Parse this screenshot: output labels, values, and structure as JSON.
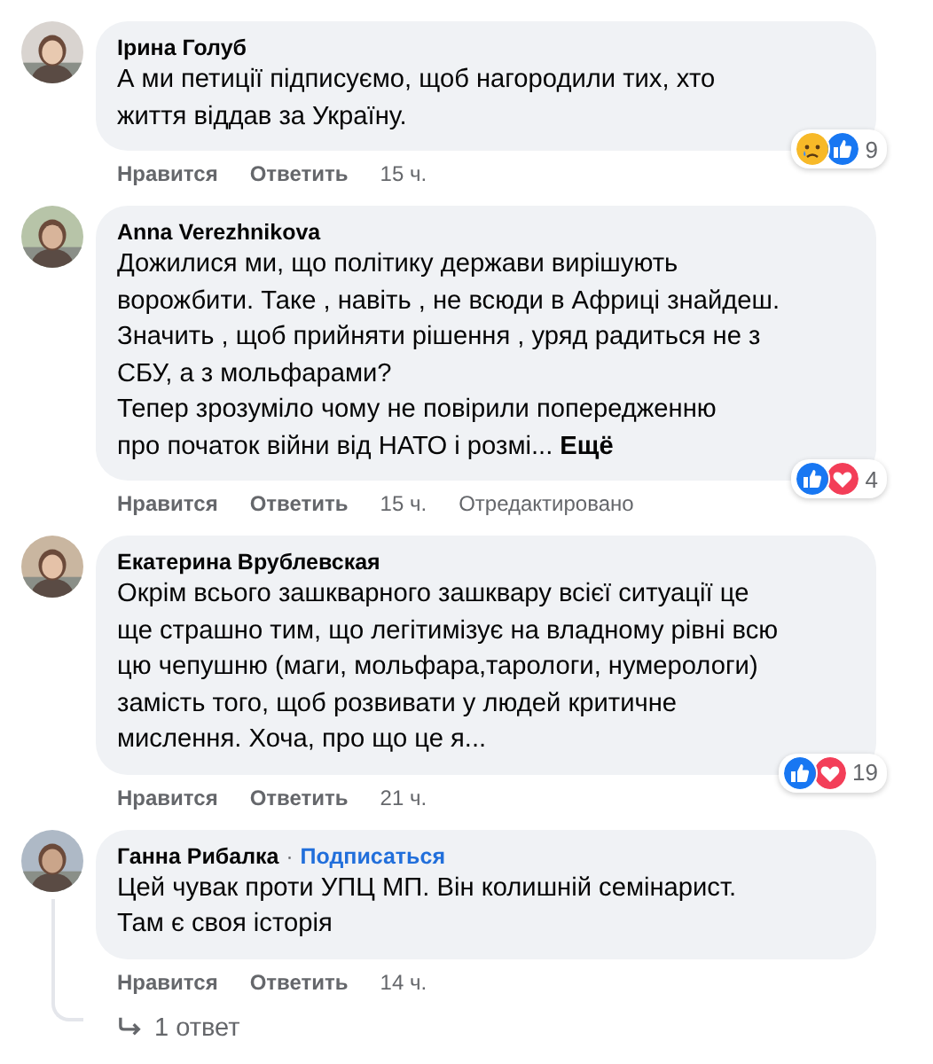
{
  "comments": [
    {
      "author": "Ірина Голуб",
      "body": "А ми петиції підписуємо, щоб нагородили тих, хто\nжиття віддав за Україну.",
      "reactions": [
        {
          "kind": "sad"
        },
        {
          "kind": "like"
        }
      ],
      "reaction_count": "9",
      "actions": [
        "Нравится",
        "Ответить"
      ],
      "time": "15 ч."
    },
    {
      "author": "Anna Verezhnikova",
      "body": "Дожилися ми, що політику держави вирішують\nворожбити. Таке , навіть , не всюди в Африці знайдеш.\nЗначить , щоб прийняти рішення , уряд радиться не з\nСБУ, а з мольфарами?\nТепер зрозуміло чому не повірили попередженню\nпро початок війни від НАТО і розмі...",
      "more_link": "Ещё",
      "reactions": [
        {
          "kind": "like"
        },
        {
          "kind": "love"
        }
      ],
      "reaction_count": "4",
      "actions": [
        "Нравится",
        "Ответить"
      ],
      "time": "15 ч.",
      "edited": "Отредактировано"
    },
    {
      "author": "Екатерина Врублевская",
      "body": "Окрім всього зашкварного зашквару всієї ситуації це\nще страшно тим, що легітимізує на владному рівні всю\nцю чепушню (маги, мольфара,тарологи, нумерологи)\nзамість того, щоб розвивати у людей критичне\nмислення. Хоча, про що це я...",
      "reactions": [
        {
          "kind": "like"
        },
        {
          "kind": "love"
        }
      ],
      "reaction_count": "19",
      "actions": [
        "Нравится",
        "Ответить"
      ],
      "time": "21 ч."
    },
    {
      "author": "Ганна Рибалка",
      "separator": "·",
      "follow": "Подписаться",
      "body": "Цей чувак проти УПЦ МП. Він колишній семінарист.\nТам є своя історія",
      "actions": [
        "Нравится",
        "Ответить"
      ],
      "time": "14 ч.",
      "replies": "1 ответ"
    }
  ]
}
